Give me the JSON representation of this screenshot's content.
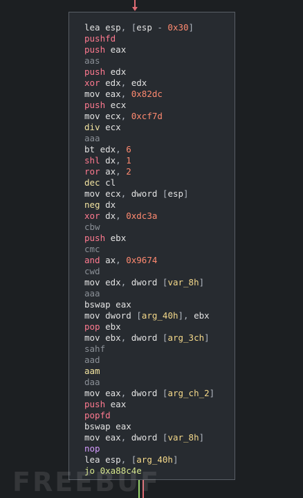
{
  "graph": {
    "edge_color_in": "#e06c75",
    "edge_color_out": "#9ad36b"
  },
  "lines": [
    {
      "m": "lea",
      "mc": "mn-normal",
      "p": [
        [
          "esp",
          "op"
        ],
        [
          ", [",
          "punc"
        ],
        [
          "esp",
          "op"
        ],
        [
          " - ",
          "punc"
        ],
        [
          "0x30",
          "num"
        ],
        [
          "]",
          "punc"
        ]
      ]
    },
    {
      "m": "pushfd",
      "mc": "mn-stack",
      "p": []
    },
    {
      "m": "push",
      "mc": "mn-stack",
      "p": [
        [
          "eax",
          "op"
        ]
      ]
    },
    {
      "m": "aas",
      "mc": "mn-dim",
      "p": []
    },
    {
      "m": "push",
      "mc": "mn-stack",
      "p": [
        [
          "edx",
          "op"
        ]
      ]
    },
    {
      "m": "xor",
      "mc": "mn-arith",
      "p": [
        [
          "edx",
          "op"
        ],
        [
          ", ",
          "punc"
        ],
        [
          "edx",
          "op"
        ]
      ]
    },
    {
      "m": "mov",
      "mc": "mn-normal",
      "p": [
        [
          "eax",
          "op"
        ],
        [
          ", ",
          "punc"
        ],
        [
          "0x82dc",
          "num"
        ]
      ]
    },
    {
      "m": "push",
      "mc": "mn-stack",
      "p": [
        [
          "ecx",
          "op"
        ]
      ]
    },
    {
      "m": "mov",
      "mc": "mn-normal",
      "p": [
        [
          "ecx",
          "op"
        ],
        [
          ", ",
          "punc"
        ],
        [
          "0xcf7d",
          "num"
        ]
      ]
    },
    {
      "m": "div",
      "mc": "mn-yellow",
      "p": [
        [
          "ecx",
          "op"
        ]
      ]
    },
    {
      "m": "aaa",
      "mc": "mn-dim",
      "p": []
    },
    {
      "m": "bt",
      "mc": "mn-normal",
      "p": [
        [
          "edx",
          "op"
        ],
        [
          ", ",
          "punc"
        ],
        [
          "6",
          "num"
        ]
      ]
    },
    {
      "m": "shl",
      "mc": "mn-arith",
      "p": [
        [
          "dx",
          "op"
        ],
        [
          ", ",
          "punc"
        ],
        [
          "1",
          "num"
        ]
      ]
    },
    {
      "m": "ror",
      "mc": "mn-arith",
      "p": [
        [
          "ax",
          "op"
        ],
        [
          ", ",
          "punc"
        ],
        [
          "2",
          "num"
        ]
      ]
    },
    {
      "m": "dec",
      "mc": "mn-yellow",
      "p": [
        [
          "cl",
          "op"
        ]
      ]
    },
    {
      "m": "mov",
      "mc": "mn-normal",
      "p": [
        [
          "ecx",
          "op"
        ],
        [
          ", ",
          "punc"
        ],
        [
          "dword",
          "op"
        ],
        [
          " [",
          "punc"
        ],
        [
          "esp",
          "op"
        ],
        [
          "]",
          "punc"
        ]
      ]
    },
    {
      "m": "neg",
      "mc": "mn-yellow",
      "p": [
        [
          "dx",
          "op"
        ]
      ]
    },
    {
      "m": "xor",
      "mc": "mn-arith",
      "p": [
        [
          "dx",
          "op"
        ],
        [
          ", ",
          "punc"
        ],
        [
          "0xdc3a",
          "num"
        ]
      ]
    },
    {
      "m": "cbw",
      "mc": "mn-dim",
      "p": []
    },
    {
      "m": "push",
      "mc": "mn-stack",
      "p": [
        [
          "ebx",
          "op"
        ]
      ]
    },
    {
      "m": "cmc",
      "mc": "mn-dim",
      "p": []
    },
    {
      "m": "and",
      "mc": "mn-arith",
      "p": [
        [
          "ax",
          "op"
        ],
        [
          ", ",
          "punc"
        ],
        [
          "0x9674",
          "num"
        ]
      ]
    },
    {
      "m": "cwd",
      "mc": "mn-dim",
      "p": []
    },
    {
      "m": "mov",
      "mc": "mn-normal",
      "p": [
        [
          "edx",
          "op"
        ],
        [
          ", ",
          "punc"
        ],
        [
          "dword",
          "op"
        ],
        [
          " [",
          "punc"
        ],
        [
          "var_8h",
          "sym"
        ],
        [
          "]",
          "punc"
        ]
      ]
    },
    {
      "m": "aaa",
      "mc": "mn-dim",
      "p": []
    },
    {
      "m": "bswap",
      "mc": "mn-normal",
      "p": [
        [
          "eax",
          "op"
        ]
      ]
    },
    {
      "m": "mov",
      "mc": "mn-normal",
      "p": [
        [
          "dword",
          "op"
        ],
        [
          " [",
          "punc"
        ],
        [
          "arg_40h",
          "sym"
        ],
        [
          "], ",
          "punc"
        ],
        [
          "ebx",
          "op"
        ]
      ]
    },
    {
      "m": "pop",
      "mc": "mn-stack",
      "p": [
        [
          "ebx",
          "op"
        ]
      ]
    },
    {
      "m": "mov",
      "mc": "mn-normal",
      "p": [
        [
          "ebx",
          "op"
        ],
        [
          ", ",
          "punc"
        ],
        [
          "dword",
          "op"
        ],
        [
          " [",
          "punc"
        ],
        [
          "arg_3ch",
          "sym"
        ],
        [
          "]",
          "punc"
        ]
      ]
    },
    {
      "m": "sahf",
      "mc": "mn-dim",
      "p": []
    },
    {
      "m": "aad",
      "mc": "mn-dim",
      "p": []
    },
    {
      "m": "aam",
      "mc": "mn-yellow",
      "p": []
    },
    {
      "m": "daa",
      "mc": "mn-dim",
      "p": []
    },
    {
      "m": "mov",
      "mc": "mn-normal",
      "p": [
        [
          "eax",
          "op"
        ],
        [
          ", ",
          "punc"
        ],
        [
          "dword",
          "op"
        ],
        [
          " [",
          "punc"
        ],
        [
          "arg_ch_2",
          "sym"
        ],
        [
          "]",
          "punc"
        ]
      ]
    },
    {
      "m": "push",
      "mc": "mn-stack",
      "p": [
        [
          "eax",
          "op"
        ]
      ]
    },
    {
      "m": "popfd",
      "mc": "mn-stack",
      "p": []
    },
    {
      "m": "bswap",
      "mc": "mn-normal",
      "p": [
        [
          "eax",
          "op"
        ]
      ]
    },
    {
      "m": "mov",
      "mc": "mn-normal",
      "p": [
        [
          "eax",
          "op"
        ],
        [
          ", ",
          "punc"
        ],
        [
          "dword",
          "op"
        ],
        [
          " [",
          "punc"
        ],
        [
          "var_8h",
          "sym"
        ],
        [
          "]",
          "punc"
        ]
      ]
    },
    {
      "m": "nop",
      "mc": "mn-purple",
      "p": []
    },
    {
      "m": "lea",
      "mc": "mn-normal",
      "p": [
        [
          "esp",
          "op"
        ],
        [
          ", [",
          "punc"
        ],
        [
          "arg_40h",
          "sym"
        ],
        [
          "]",
          "punc"
        ]
      ]
    },
    {
      "m": "jo",
      "mc": "mn-green",
      "p": [
        [
          "0xa88c4e",
          "mn-green"
        ]
      ]
    }
  ],
  "watermark": {
    "text": "FREEBUF"
  }
}
